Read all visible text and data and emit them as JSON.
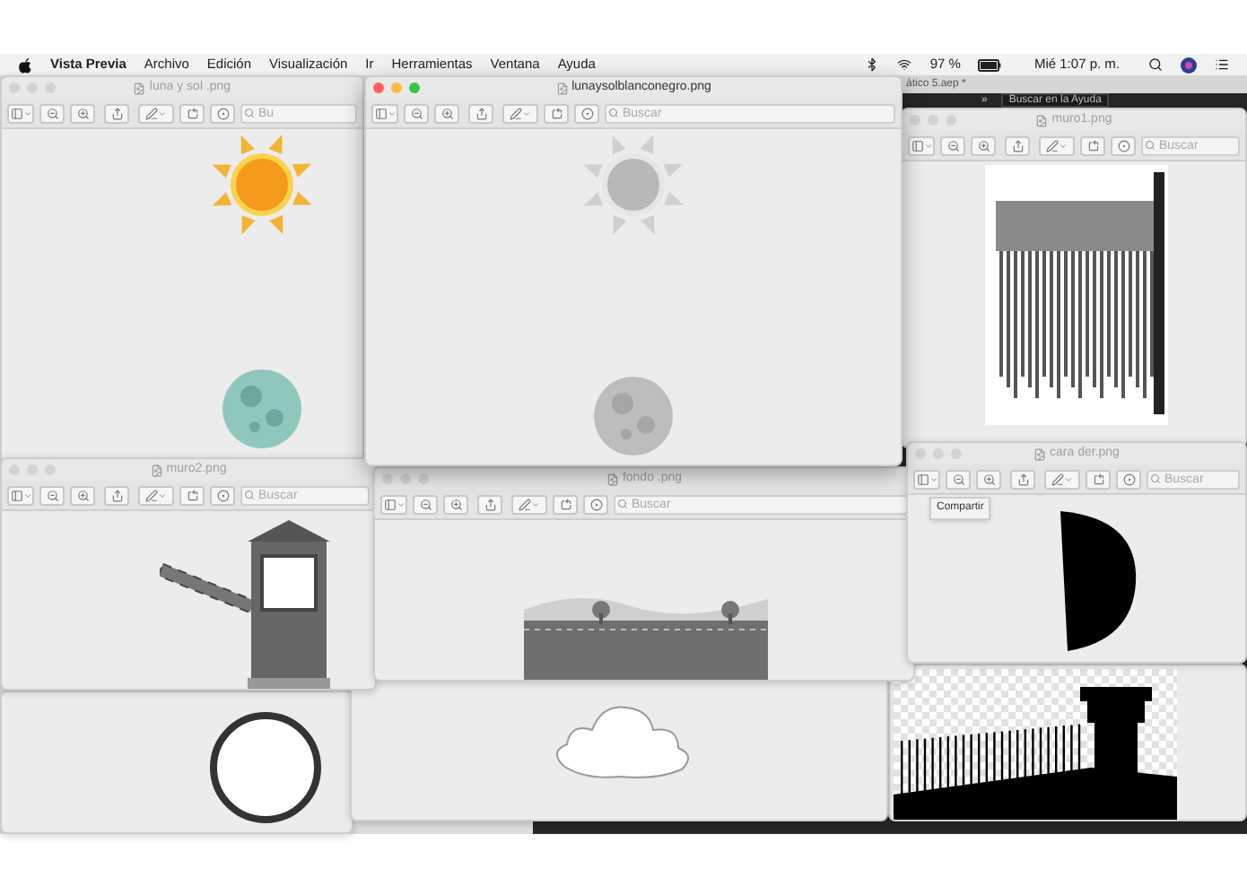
{
  "menu_bar": {
    "app": "Vista Previa",
    "items": [
      "Archivo",
      "Edición",
      "Visualización",
      "Ir",
      "Herramientas",
      "Ventana",
      "Ayuda"
    ],
    "battery": "97 %",
    "clock": "Mié 1:07 p. m."
  },
  "windows": [
    {
      "kind": "sun-moon-color",
      "title": "luna y sol .png",
      "search_placeholder": "Bu",
      "active": false
    },
    {
      "kind": "sun-moon-grey",
      "title": "lunaysolblanconegro.png",
      "search_placeholder": "Buscar",
      "active": true
    },
    {
      "kind": "editor",
      "title": "ático 5.aep *",
      "overflow": "»",
      "help_search": "Buscar en la Ayuda"
    },
    {
      "kind": "wall",
      "title": "muro1.png",
      "search_placeholder": "Buscar",
      "active": false
    },
    {
      "kind": "booth",
      "title": "muro2.png",
      "search_placeholder": "Buscar",
      "active": false
    },
    {
      "kind": "landscape",
      "title": "fondo .png",
      "search_placeholder": "Buscar",
      "active": false
    },
    {
      "kind": "d-shape",
      "title": "cara der.png",
      "search_placeholder": "Buscar",
      "tooltip": "Compartir",
      "active": false
    },
    {
      "kind": "circle"
    },
    {
      "kind": "cloud",
      "active": false
    },
    {
      "kind": "silhouette"
    }
  ]
}
